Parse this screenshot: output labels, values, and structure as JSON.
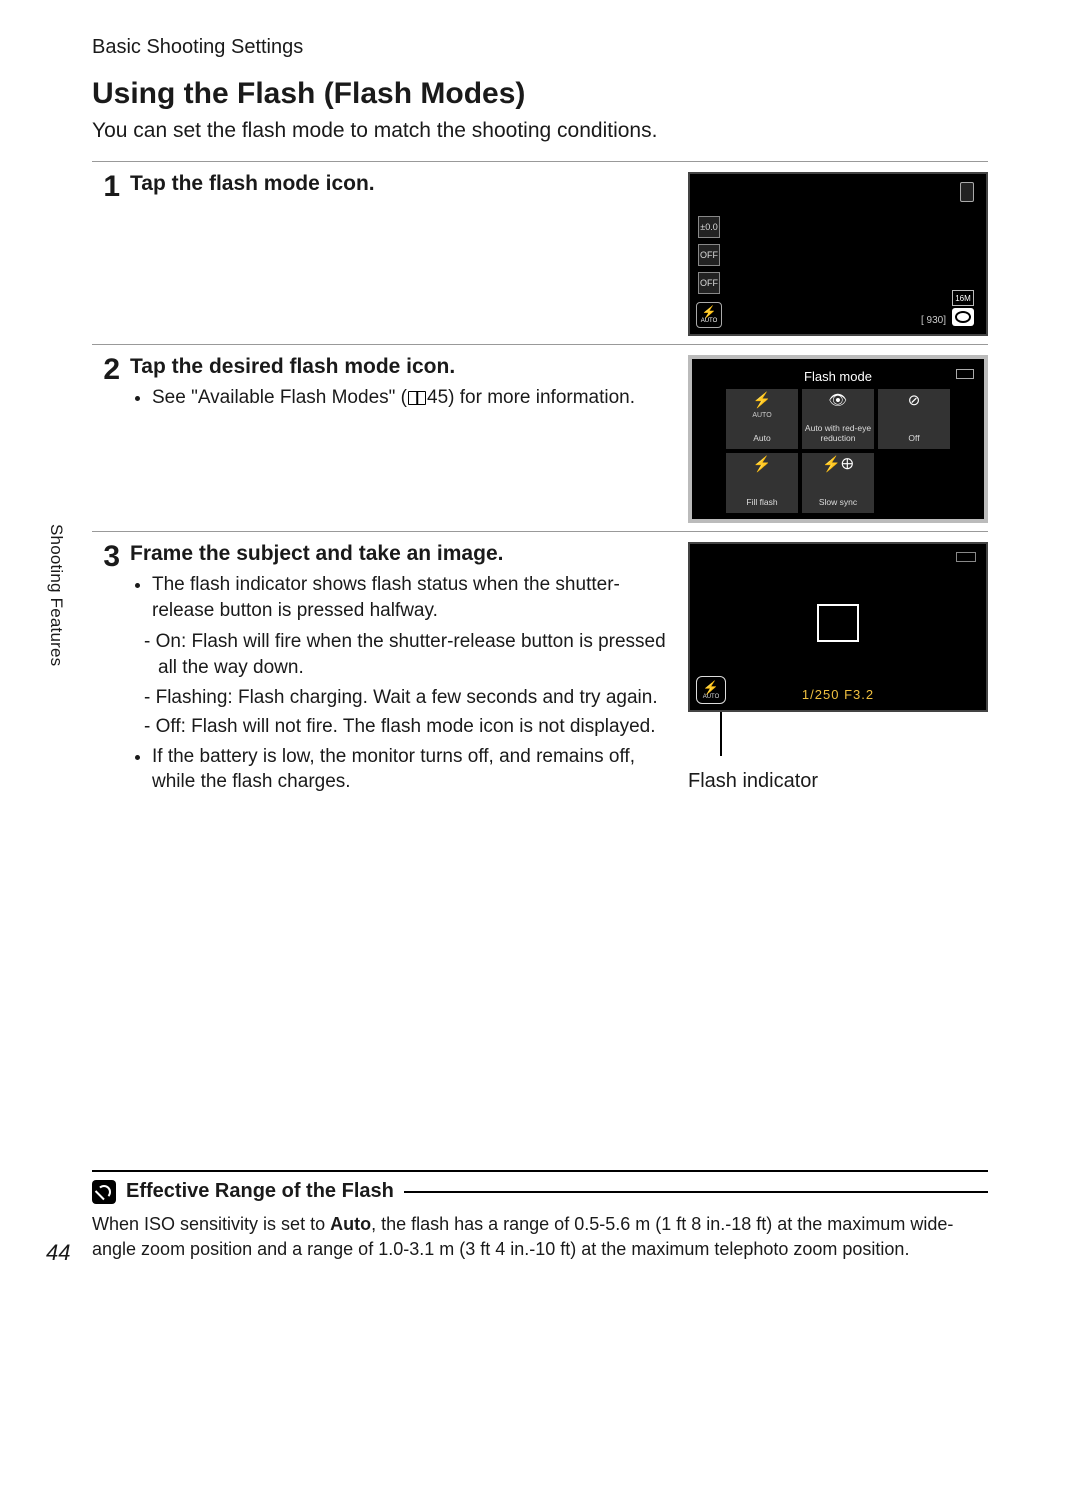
{
  "breadcrumb": "Basic Shooting Settings",
  "side_tab": "Shooting Features",
  "page_number": "44",
  "heading": "Using the Flash (Flash Modes)",
  "intro": "You can set the flash mode to match the shooting conditions.",
  "steps": [
    {
      "num": "1",
      "title": "Tap the flash mode icon."
    },
    {
      "num": "2",
      "title": "Tap the desired flash mode icon.",
      "bullet_pre": "See \"Available Flash Modes\" (",
      "bullet_ref": "45",
      "bullet_post": ") for more information."
    },
    {
      "num": "3",
      "title": "Frame the subject and take an image.",
      "b1": "The flash indicator shows flash status when the shutter-release button is pressed halfway.",
      "d1": "On: Flash will fire when the shutter-release button is pressed all the way down.",
      "d2": "Flashing: Flash charging. Wait a few seconds and try again.",
      "d3": "Off: Flash will not fire. The flash mode icon is not displayed.",
      "b2": "If the battery is low, the monitor turns off, and remains off, while the flash charges.",
      "indicator_label": "Flash indicator"
    }
  ],
  "screen1": {
    "ev_badge": "±0.0",
    "macro_off": "OFF",
    "timer_off": "OFF",
    "flash_auto_sym": "⚡",
    "flash_auto_txt": "AUTO",
    "resolution": "16M",
    "shots_remaining": "[ 930]"
  },
  "screen2": {
    "title": "Flash mode",
    "cells": [
      {
        "ico": "⚡",
        "sub": "AUTO",
        "lab": "Auto"
      },
      {
        "ico": "👁",
        "sub": "",
        "lab": "Auto with red-eye reduction"
      },
      {
        "ico": "⊘",
        "sub": "",
        "lab": "Off"
      },
      {
        "ico": "⚡",
        "sub": "",
        "lab": "Fill flash"
      },
      {
        "ico": "⚡🜨",
        "sub": "",
        "lab": "Slow sync"
      }
    ]
  },
  "screen3": {
    "exposure_info": "1/250 F3.2",
    "ind_sym": "⚡",
    "ind_txt": "AUTO"
  },
  "note": {
    "title": "Effective Range of the Flash",
    "body_pre": "When ISO sensitivity is set to ",
    "body_bold": "Auto",
    "body_post": ", the flash has a range of 0.5-5.6 m (1 ft 8 in.-18 ft) at the maximum wide-angle zoom position and a range of 1.0-3.1 m (3 ft 4 in.-10 ft) at the maximum telephoto zoom position."
  }
}
